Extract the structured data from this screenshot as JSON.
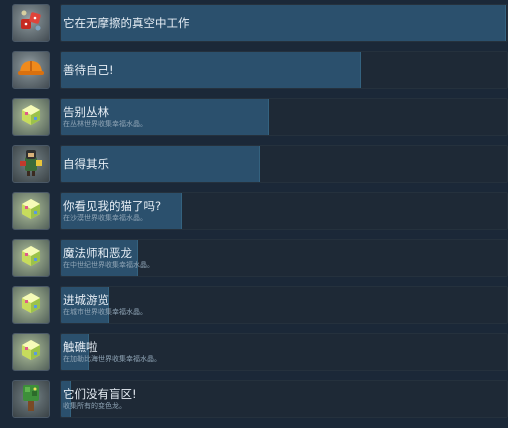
{
  "achievements": [
    {
      "title": "它在无摩擦的真空中工作",
      "description": "",
      "progress": 0.995,
      "icon": "red-dice-icon"
    },
    {
      "title": "善待自己!",
      "description": "",
      "progress": 0.67,
      "icon": "orange-hardhat-icon"
    },
    {
      "title": "告别丛林",
      "description": "在丛林世界收集幸福水晶。",
      "progress": 0.465,
      "icon": "crystal-cube-icon"
    },
    {
      "title": "自得其乐",
      "description": "",
      "progress": 0.445,
      "icon": "party-character-icon"
    },
    {
      "title": "你看见我的猫了吗?",
      "description": "在沙漠世界收集幸福水晶。",
      "progress": 0.27,
      "icon": "crystal-cube-icon"
    },
    {
      "title": "魔法师和恶龙",
      "description": "在中世纪世界收集幸福水晶。",
      "progress": 0.17,
      "icon": "crystal-cube-icon"
    },
    {
      "title": "进城游览",
      "description": "在城市世界收集幸福水晶。",
      "progress": 0.105,
      "icon": "crystal-cube-icon"
    },
    {
      "title": "触礁啦",
      "description": "在加勒比海世界收集幸福水晶。",
      "progress": 0.06,
      "icon": "crystal-cube-icon"
    },
    {
      "title": "它们没有盲区!",
      "description": "收集所有的变色龙。",
      "progress": 0.02,
      "icon": "chameleon-tree-icon"
    }
  ]
}
